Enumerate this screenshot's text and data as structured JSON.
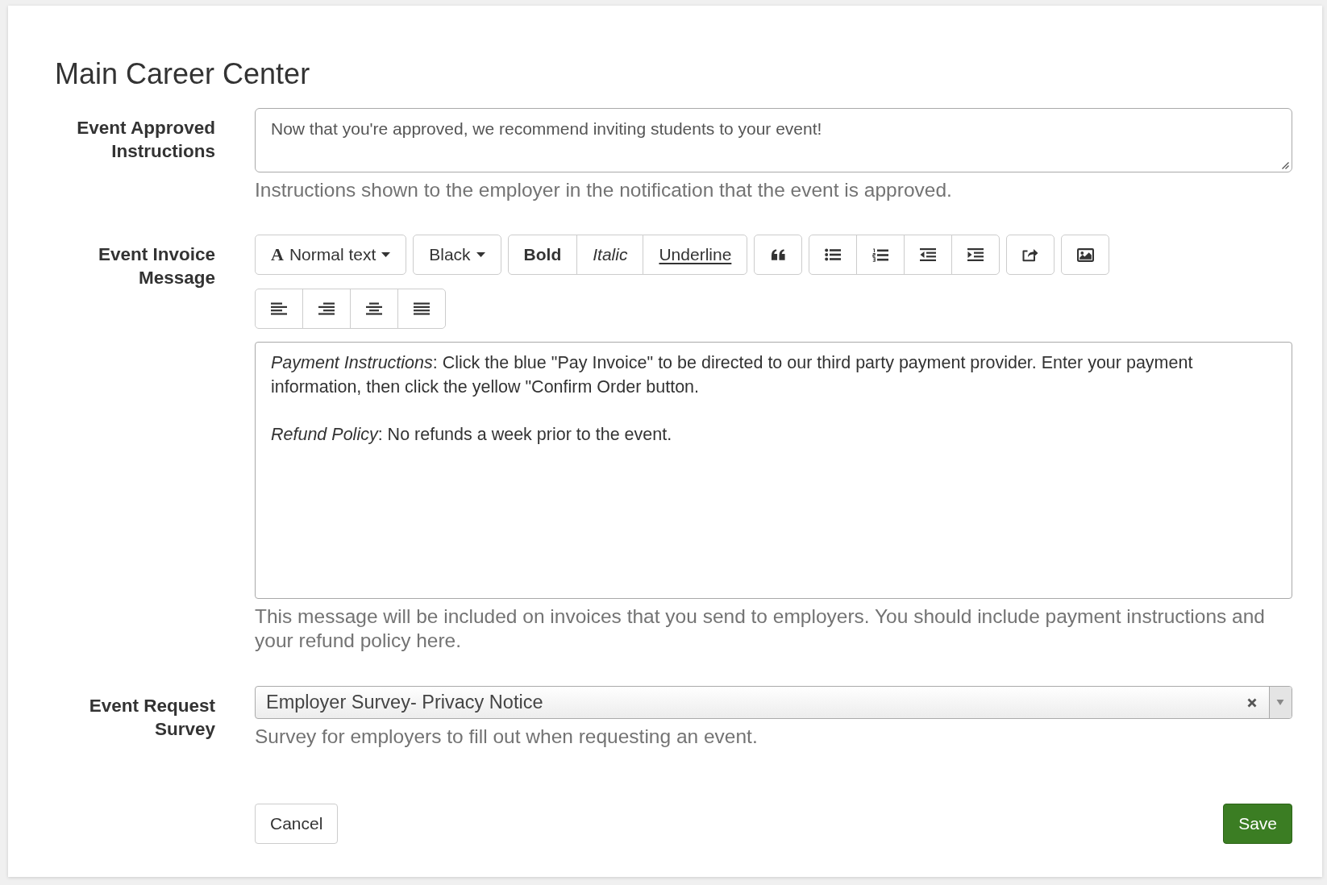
{
  "title": "Main Career Center",
  "fields": [
    {
      "kind": "textarea",
      "label": "Event Approved Instructions",
      "value": "Now that you're approved, we recommend inviting students to your event!",
      "help": "Instructions shown to the employer in the notification that the event is approved."
    },
    {
      "kind": "rich_editor",
      "label": "Event Invoice Message",
      "toolbar": [
        {
          "groups": [
            {
              "buttons": [
                {
                  "kind": "dropdown",
                  "glyph": "A",
                  "label": "Normal text"
                }
              ]
            },
            {
              "buttons": [
                {
                  "kind": "dropdown",
                  "label": "Black"
                }
              ]
            },
            {
              "buttons": [
                {
                  "kind": "text",
                  "label": "Bold"
                },
                {
                  "kind": "text",
                  "label": "Italic"
                },
                {
                  "kind": "text",
                  "label": "Underline"
                }
              ]
            },
            {
              "buttons": [
                {
                  "kind": "icon"
                }
              ]
            },
            {
              "buttons": [
                {
                  "kind": "icon"
                },
                {
                  "kind": "icon"
                },
                {
                  "kind": "icon"
                },
                {
                  "kind": "icon"
                }
              ]
            },
            {
              "buttons": [
                {
                  "kind": "icon"
                }
              ]
            },
            {
              "buttons": [
                {
                  "kind": "icon"
                }
              ]
            }
          ]
        },
        {
          "groups": [
            {
              "buttons": [
                {
                  "kind": "icon"
                },
                {
                  "kind": "icon"
                },
                {
                  "kind": "icon"
                },
                {
                  "kind": "icon"
                }
              ]
            }
          ]
        }
      ],
      "paragraphs": [
        "*Payment Instructions*: Click the blue \"Pay Invoice\" to be directed to our third party payment provider. Enter your payment information, then click the yellow \"Confirm Order button.",
        "*Refund Policy*: No refunds a week prior to the event."
      ],
      "help": "This message will be included on invoices that you send to employers. You should include payment instructions and your refund policy here."
    },
    {
      "kind": "select",
      "label": "Event Request Survey",
      "value": "Employer Survey- Privacy Notice",
      "help": "Survey for employers to fill out when requesting an event."
    }
  ],
  "buttons": [
    {
      "kind": "default",
      "label": "Cancel"
    },
    {
      "kind": "primary",
      "label": "Save"
    }
  ]
}
